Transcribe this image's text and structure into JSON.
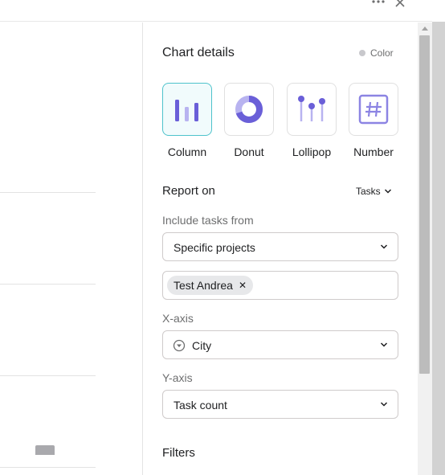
{
  "window": {
    "more_icon": "more-horizontal-icon",
    "close_icon": "close-icon"
  },
  "panel": {
    "title": "Chart details",
    "color_toggle": {
      "label": "Color",
      "icon": "color-dot-icon"
    },
    "chart_types": [
      {
        "label": "Column",
        "icon": "column-chart-icon",
        "selected": true
      },
      {
        "label": "Donut",
        "icon": "donut-chart-icon",
        "selected": false
      },
      {
        "label": "Lollipop",
        "icon": "lollipop-chart-icon",
        "selected": false
      },
      {
        "label": "Number",
        "icon": "number-chart-icon",
        "selected": false
      }
    ],
    "report_on": {
      "label": "Report on",
      "value": "Tasks"
    },
    "include_tasks": {
      "label": "Include tasks from",
      "value": "Specific projects",
      "tokens": [
        "Test Andrea"
      ]
    },
    "x_axis": {
      "label": "X-axis",
      "value": "City",
      "icon": "dropdown-field-icon"
    },
    "y_axis": {
      "label": "Y-axis",
      "value": "Task count"
    },
    "filters": {
      "label": "Filters"
    }
  },
  "colors": {
    "accent": "#4ec3cc",
    "chart_purple": "#6a5fd8",
    "chart_light_purple": "#b8b3f0"
  }
}
